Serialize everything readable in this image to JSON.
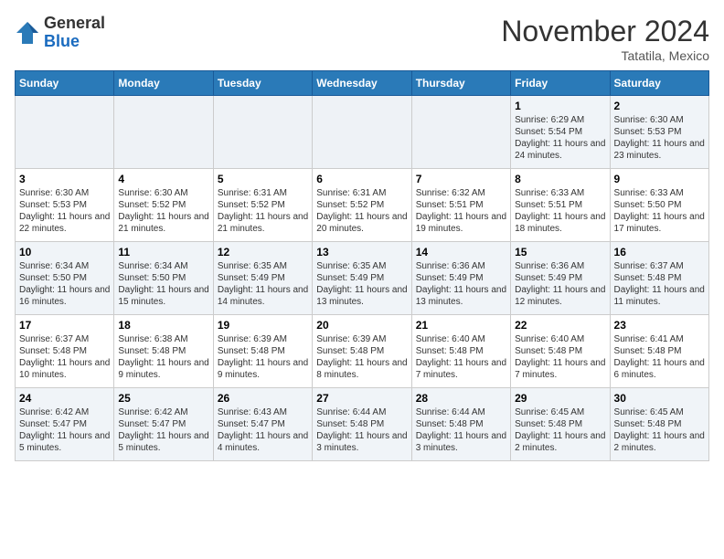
{
  "logo": {
    "general": "General",
    "blue": "Blue"
  },
  "header": {
    "month": "November 2024",
    "location": "Tatatila, Mexico"
  },
  "weekdays": [
    "Sunday",
    "Monday",
    "Tuesday",
    "Wednesday",
    "Thursday",
    "Friday",
    "Saturday"
  ],
  "weeks": [
    [
      {
        "day": "",
        "info": ""
      },
      {
        "day": "",
        "info": ""
      },
      {
        "day": "",
        "info": ""
      },
      {
        "day": "",
        "info": ""
      },
      {
        "day": "",
        "info": ""
      },
      {
        "day": "1",
        "info": "Sunrise: 6:29 AM\nSunset: 5:54 PM\nDaylight: 11 hours and 24 minutes."
      },
      {
        "day": "2",
        "info": "Sunrise: 6:30 AM\nSunset: 5:53 PM\nDaylight: 11 hours and 23 minutes."
      }
    ],
    [
      {
        "day": "3",
        "info": "Sunrise: 6:30 AM\nSunset: 5:53 PM\nDaylight: 11 hours and 22 minutes."
      },
      {
        "day": "4",
        "info": "Sunrise: 6:30 AM\nSunset: 5:52 PM\nDaylight: 11 hours and 21 minutes."
      },
      {
        "day": "5",
        "info": "Sunrise: 6:31 AM\nSunset: 5:52 PM\nDaylight: 11 hours and 21 minutes."
      },
      {
        "day": "6",
        "info": "Sunrise: 6:31 AM\nSunset: 5:52 PM\nDaylight: 11 hours and 20 minutes."
      },
      {
        "day": "7",
        "info": "Sunrise: 6:32 AM\nSunset: 5:51 PM\nDaylight: 11 hours and 19 minutes."
      },
      {
        "day": "8",
        "info": "Sunrise: 6:33 AM\nSunset: 5:51 PM\nDaylight: 11 hours and 18 minutes."
      },
      {
        "day": "9",
        "info": "Sunrise: 6:33 AM\nSunset: 5:50 PM\nDaylight: 11 hours and 17 minutes."
      }
    ],
    [
      {
        "day": "10",
        "info": "Sunrise: 6:34 AM\nSunset: 5:50 PM\nDaylight: 11 hours and 16 minutes."
      },
      {
        "day": "11",
        "info": "Sunrise: 6:34 AM\nSunset: 5:50 PM\nDaylight: 11 hours and 15 minutes."
      },
      {
        "day": "12",
        "info": "Sunrise: 6:35 AM\nSunset: 5:49 PM\nDaylight: 11 hours and 14 minutes."
      },
      {
        "day": "13",
        "info": "Sunrise: 6:35 AM\nSunset: 5:49 PM\nDaylight: 11 hours and 13 minutes."
      },
      {
        "day": "14",
        "info": "Sunrise: 6:36 AM\nSunset: 5:49 PM\nDaylight: 11 hours and 13 minutes."
      },
      {
        "day": "15",
        "info": "Sunrise: 6:36 AM\nSunset: 5:49 PM\nDaylight: 11 hours and 12 minutes."
      },
      {
        "day": "16",
        "info": "Sunrise: 6:37 AM\nSunset: 5:48 PM\nDaylight: 11 hours and 11 minutes."
      }
    ],
    [
      {
        "day": "17",
        "info": "Sunrise: 6:37 AM\nSunset: 5:48 PM\nDaylight: 11 hours and 10 minutes."
      },
      {
        "day": "18",
        "info": "Sunrise: 6:38 AM\nSunset: 5:48 PM\nDaylight: 11 hours and 9 minutes."
      },
      {
        "day": "19",
        "info": "Sunrise: 6:39 AM\nSunset: 5:48 PM\nDaylight: 11 hours and 9 minutes."
      },
      {
        "day": "20",
        "info": "Sunrise: 6:39 AM\nSunset: 5:48 PM\nDaylight: 11 hours and 8 minutes."
      },
      {
        "day": "21",
        "info": "Sunrise: 6:40 AM\nSunset: 5:48 PM\nDaylight: 11 hours and 7 minutes."
      },
      {
        "day": "22",
        "info": "Sunrise: 6:40 AM\nSunset: 5:48 PM\nDaylight: 11 hours and 7 minutes."
      },
      {
        "day": "23",
        "info": "Sunrise: 6:41 AM\nSunset: 5:48 PM\nDaylight: 11 hours and 6 minutes."
      }
    ],
    [
      {
        "day": "24",
        "info": "Sunrise: 6:42 AM\nSunset: 5:47 PM\nDaylight: 11 hours and 5 minutes."
      },
      {
        "day": "25",
        "info": "Sunrise: 6:42 AM\nSunset: 5:47 PM\nDaylight: 11 hours and 5 minutes."
      },
      {
        "day": "26",
        "info": "Sunrise: 6:43 AM\nSunset: 5:47 PM\nDaylight: 11 hours and 4 minutes."
      },
      {
        "day": "27",
        "info": "Sunrise: 6:44 AM\nSunset: 5:48 PM\nDaylight: 11 hours and 3 minutes."
      },
      {
        "day": "28",
        "info": "Sunrise: 6:44 AM\nSunset: 5:48 PM\nDaylight: 11 hours and 3 minutes."
      },
      {
        "day": "29",
        "info": "Sunrise: 6:45 AM\nSunset: 5:48 PM\nDaylight: 11 hours and 2 minutes."
      },
      {
        "day": "30",
        "info": "Sunrise: 6:45 AM\nSunset: 5:48 PM\nDaylight: 11 hours and 2 minutes."
      }
    ]
  ]
}
